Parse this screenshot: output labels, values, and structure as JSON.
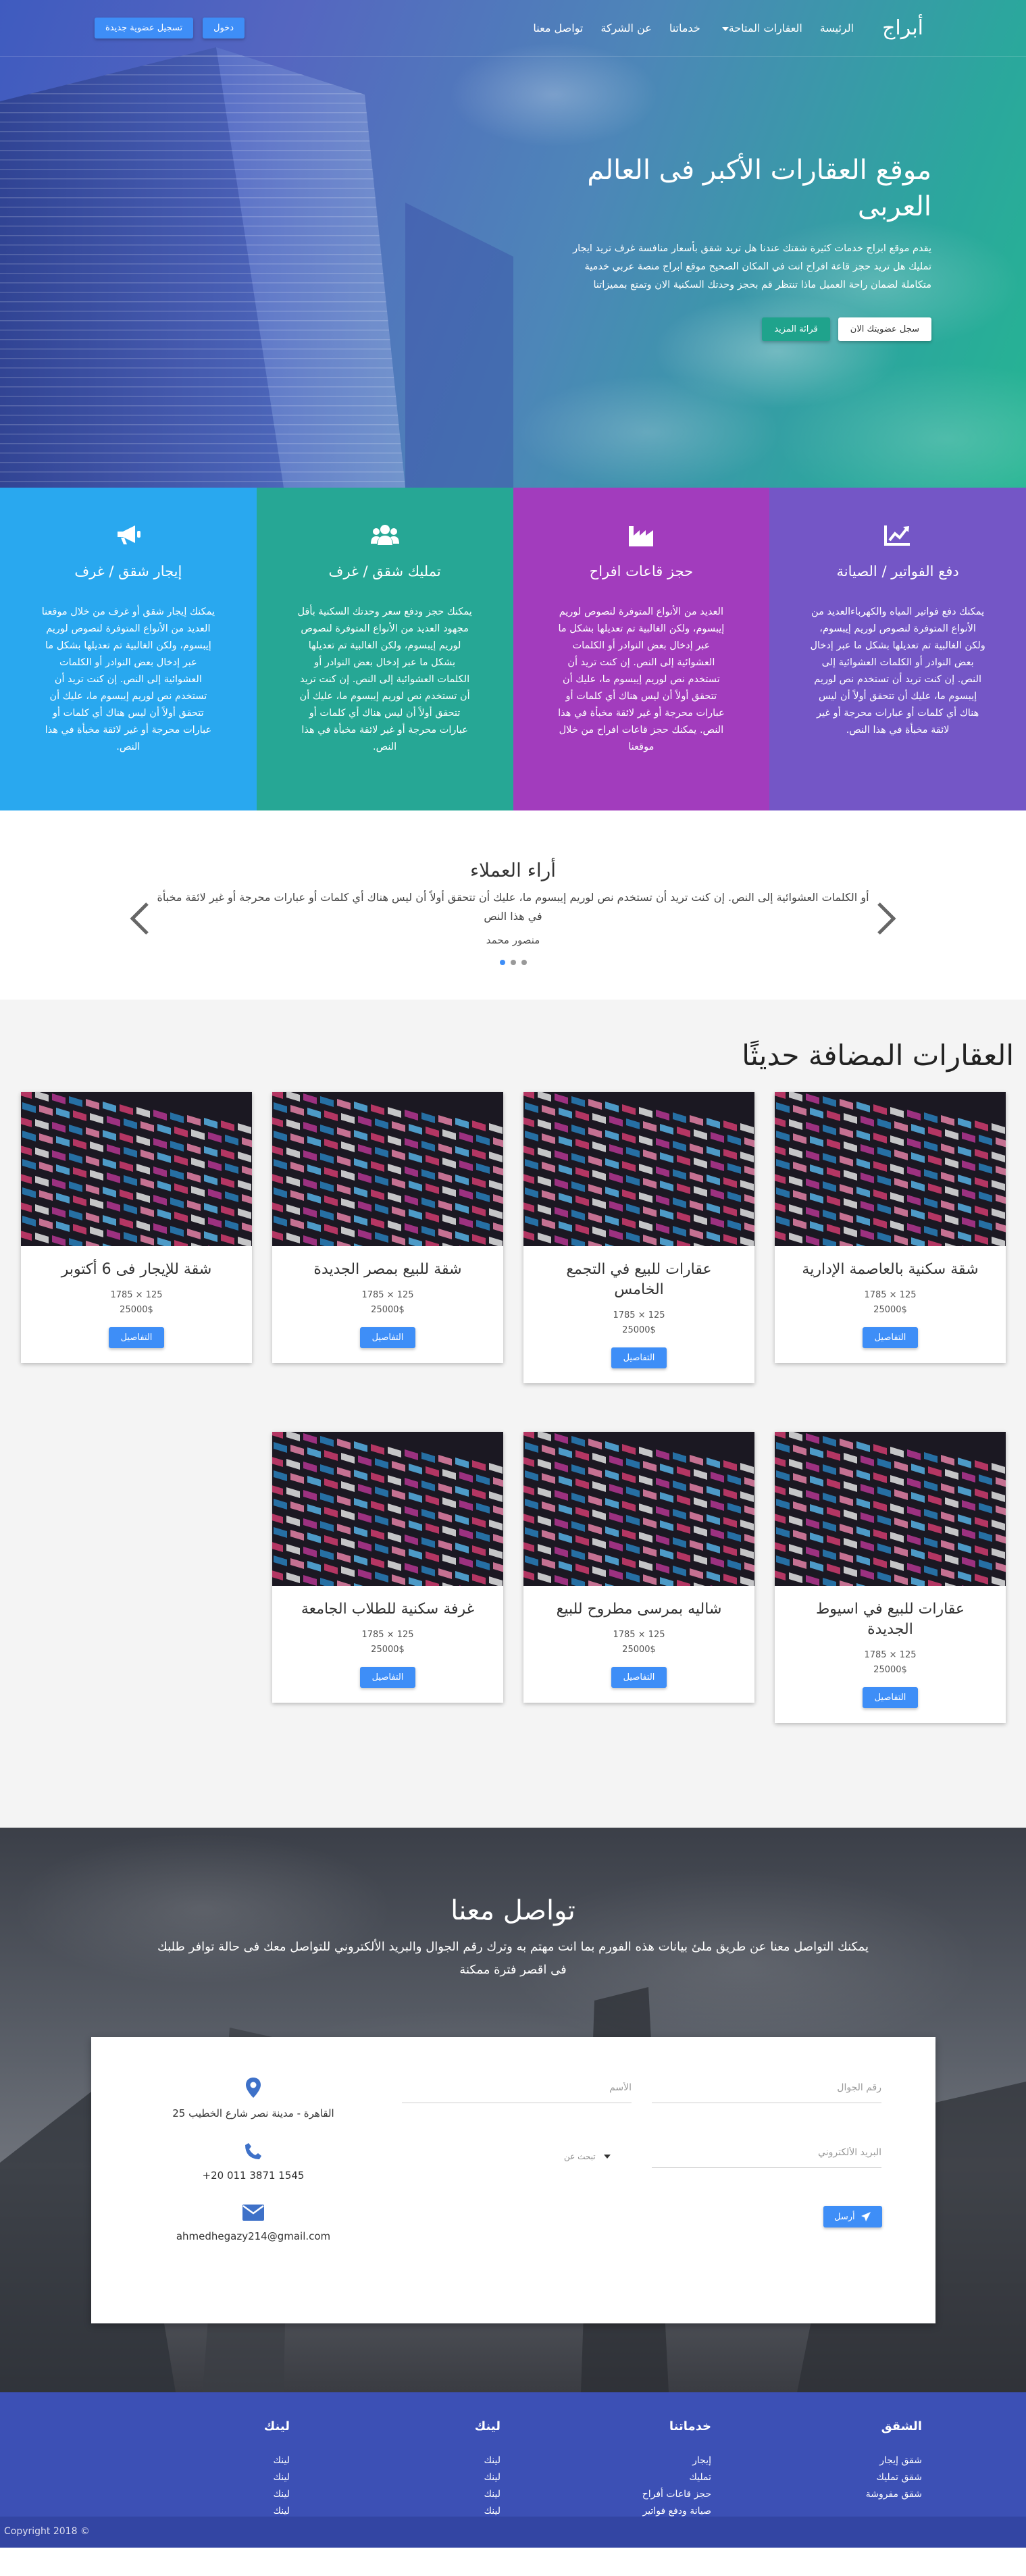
{
  "colors": {
    "accent": "#3e8ef7",
    "hero_teal": "#25b592",
    "svc_1": "#29a8ef",
    "svc_2": "#26a795",
    "svc_3": "#a23cbd",
    "svc_4": "#7456c6",
    "footer": "#3c50b5"
  },
  "navbar": {
    "brand": "أبراج",
    "links": [
      "الرئيسة",
      "العقارات المتاحة",
      "خدماتنا",
      "عن الشركة",
      "تواصل معنا"
    ],
    "login": "دخول",
    "register": "تسجيل عضوية جديدة"
  },
  "hero": {
    "title": "موقع العقارات الأكبر فى العالم العربى",
    "text": "يقدم موقع ابراج خدمات كثيرة شقتك عندنا هل تريد شقق بأسعار منافسة غرف تريد ايجار تمليك هل تريد حجز قاعة افراح انت في المكان الصحيح موقع ابراج منصة عربي خدمية متكاملة لضمان راحة العميل ماذا تنتظر قم بحجز وحدتك السكنية الان وتمتع بمميزاتنا",
    "btn_register": "سجل عضويتك الان",
    "btn_more": "قرائة المزيد"
  },
  "services": [
    {
      "icon": "chart-icon",
      "title": "دفع الفواتير / الصيانة",
      "text": "يمكنك دفع فواتير المياه والكهرباءالعديد من الأنواع المتوفرة لنصوص لوريم إيبسوم، ولكن الغالبية تم تعديلها بشكل ما عبر إدخال بعض النوادر أو الكلمات العشوائية إلى النص. إن كنت تريد أن تستخدم نص لوريم إيبسوم ما، عليك أن تتحقق أولاً أن ليس هناك أي كلمات أو عبارات محرجة أو غير لائقة مخبأة في هذا النص."
    },
    {
      "icon": "factory-icon",
      "title": "حجز قاعات افراح",
      "text": "العديد من الأنواع المتوفرة لنصوص لوريم إيبسوم، ولكن الغالبية تم تعديلها بشكل ما عبر إدخال بعض النوادر أو الكلمات العشوائية إلى النص. إن كنت تريد أن تستخدم نص لوريم إيبسوم ما، عليك أن تتحقق أولاً أن ليس هناك أي كلمات أو عبارات محرجة أو غير لائقة مخبأة في هذا النص. يمكنك حجز قاعات افراح من خلال موقعنا"
    },
    {
      "icon": "users-icon",
      "title": "تمليك شقق / غرف",
      "text": "يمكنك حجز ودفع سعر وحدتك السكنية بأقل مجهود العديد من الأنواع المتوفرة لنصوص لوريم إيبسوم، ولكن الغالبية تم تعديلها بشكل ما عبر إدخال بعض النوادر أو الكلمات العشوائية إلى النص. إن كنت تريد أن تستخدم نص لوريم إيبسوم ما، عليك أن تتحقق أولاً أن ليس هناك أي كلمات أو عبارات محرجة أو غير لائقة مخبأة في هذا النص."
    },
    {
      "icon": "megaphone-icon",
      "title": "إيجار شقق / غرف",
      "text": "يمكنك إيجار شقق أو غرف من خلال موقعنا العديد من الأنواع المتوفرة لنصوص لوريم إيبسوم، ولكن الغالبية تم تعديلها بشكل ما عبر إدخال بعض النوادر أو الكلمات العشوائية إلى النص. إن كنت تريد أن تستخدم نص لوريم إيبسوم ما، عليك أن تتحقق أولاً أن ليس هناك أي كلمات أو عبارات محرجة أو غير لائقة مخبأة في هذا النص."
    }
  ],
  "testimonials": {
    "title": "أراء العملاء",
    "quote": "أو الكلمات العشوائية إلى النص. إن كنت تريد أن تستخدم نص لوريم إيبسوم ما، عليك أن تتحقق أولاً أن ليس هناك أي كلمات أو عبارات محرجة أو غير لائقة مخبأة في هذا النص",
    "author": "منصور محمد",
    "dots": 3,
    "active_dot": 2
  },
  "properties": {
    "title": "العقارات المضافة حديثًا",
    "details_label": "التفاصيل",
    "items": [
      {
        "title": "شقة سكنية بالعاصمة الإدارية",
        "area": "125 × 1785",
        "price": "25000$"
      },
      {
        "title": "عقارات للبيع في التجمع الخامس",
        "area": "125 × 1785",
        "price": "25000$"
      },
      {
        "title": "شقة للبيع بمصر الجديدة",
        "area": "125 × 1785",
        "price": "25000$"
      },
      {
        "title": "شقة للإيجار فى 6 أكتوبر",
        "area": "125 × 1785",
        "price": "25000$"
      },
      {
        "title": "عقارات للبيع في اسيوط الجديدة",
        "area": "125 × 1785",
        "price": "25000$"
      },
      {
        "title": "شاليه بمرسى مطروح للبيع",
        "area": "125 × 1785",
        "price": "25000$"
      },
      {
        "title": "غرفة سكنية للطلاب الجامعة",
        "area": "125 × 1785",
        "price": "25000$"
      }
    ]
  },
  "contact": {
    "title": "تواصل معنا",
    "lead": "يمكنك التواصل معنا عن طريق ملئ بيانات هذه الفورم بما انت مهتم به وترك رقم الجوال والبريد الألكتروني للتواصل معك فى حالة توافر طلبك فى اقصر فترة ممكنة",
    "address": "القاهرة - مدينة نصر شارع الخطيب 25",
    "phone": "+20 011 3871 1545",
    "email": "ahmedhegazy214@gmail.com",
    "name_placeholder": "الأسم",
    "phone_placeholder": "رقم الجوال",
    "email_placeholder": "البريد الألكتروني",
    "select_label": "تبحث عن",
    "send": "أرسل"
  },
  "footer": {
    "columns": [
      {
        "title": "الشقق",
        "links": [
          "شقق إيجار",
          "شقق تمليك",
          "شقق مفروشة"
        ]
      },
      {
        "title": "خدماتنا",
        "links": [
          "إيجار",
          "تمليك",
          "حجز قاعات أفراح",
          "صيانة ودفع فواتير"
        ]
      },
      {
        "title": "لينك",
        "links": [
          "لينك",
          "لينك",
          "لينك",
          "لينك"
        ]
      },
      {
        "title": "لينك",
        "links": [
          "لينك",
          "لينك",
          "لينك",
          "لينك"
        ]
      }
    ],
    "copyright": "Copyright 2018 ©"
  }
}
